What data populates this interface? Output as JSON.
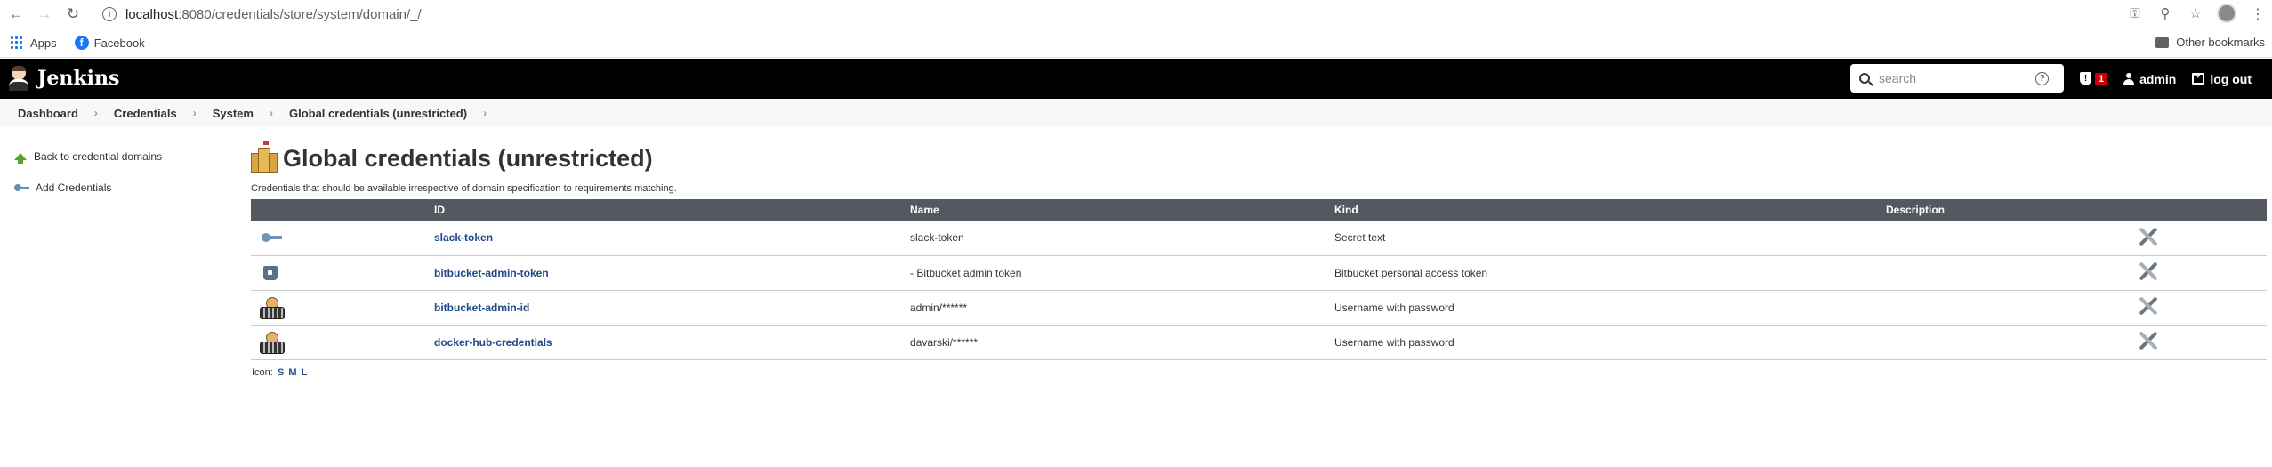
{
  "browser": {
    "url_host": "localhost",
    "url_path": ":8080/credentials/store/system/domain/_/",
    "bookmarks": [
      {
        "label": "Apps"
      },
      {
        "label": "Facebook"
      }
    ],
    "other_bookmarks": "Other bookmarks"
  },
  "header": {
    "title": "Jenkins",
    "search_placeholder": "search",
    "alert_count": "1",
    "user": "admin",
    "logout": "log out"
  },
  "breadcrumb": [
    "Dashboard",
    "Credentials",
    "System",
    "Global credentials (unrestricted)"
  ],
  "side_panel": {
    "back_label": "Back to credential domains",
    "add_label": "Add Credentials"
  },
  "main": {
    "title": "Global credentials (unrestricted)",
    "description": "Credentials that should be available irrespective of domain specification to requirements matching.",
    "columns": [
      "ID",
      "Name",
      "Kind",
      "Description"
    ],
    "rows": [
      {
        "icon": "key-icon",
        "id": "slack-token",
        "name": "slack-token",
        "kind": "Secret text",
        "description": ""
      },
      {
        "icon": "bitbucket-icon",
        "id": "bitbucket-admin-token",
        "name": "- Bitbucket admin token",
        "kind": "Bitbucket personal access token",
        "description": ""
      },
      {
        "icon": "username-password-icon",
        "id": "bitbucket-admin-id",
        "name": "admin/******",
        "kind": "Username with password",
        "description": ""
      },
      {
        "icon": "username-password-icon",
        "id": "docker-hub-credentials",
        "name": "davarski/******",
        "kind": "Username with password",
        "description": ""
      }
    ],
    "icon_label": "Icon:",
    "icon_sizes": [
      "S",
      "M",
      "L"
    ]
  }
}
